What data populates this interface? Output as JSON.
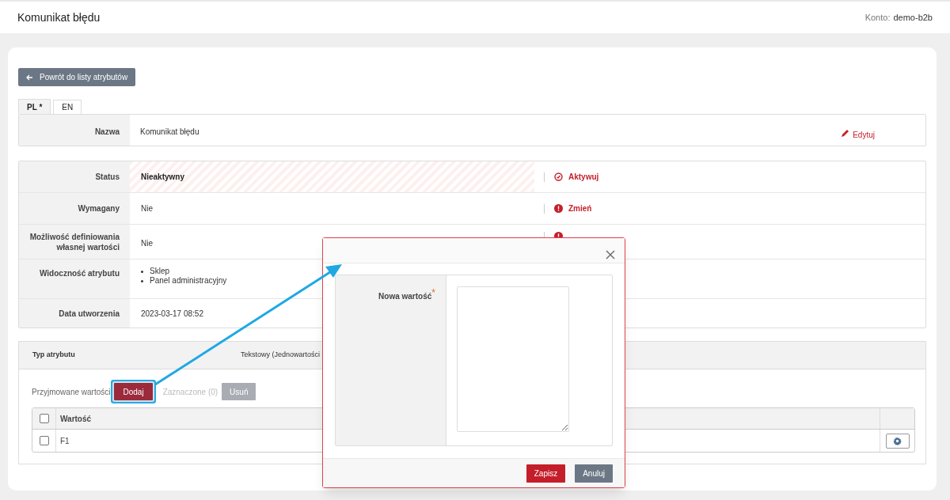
{
  "header": {
    "title": "Komunikat błędu",
    "account_label": "Konto:",
    "account": "demo-b2b"
  },
  "back_button": "Powrót do listy atrybutów",
  "tabs": [
    {
      "label": "PL *",
      "selected": true
    },
    {
      "label": "EN",
      "selected": false
    }
  ],
  "name_row": {
    "label": "Nazwa",
    "value": "Komunikat błędu",
    "action": "Edytuj"
  },
  "properties": [
    {
      "label": "Status",
      "value": "Nieaktywny",
      "kind": "status",
      "action": {
        "kind": "check",
        "label": "Aktywuj"
      }
    },
    {
      "label": "Wymagany",
      "value": "Nie",
      "kind": "text",
      "action": {
        "kind": "alert",
        "label": "Zmień"
      }
    },
    {
      "label": "Możliwość definiowania własnej wartości",
      "value": "Nie",
      "kind": "text",
      "action": {
        "kind": "alert"
      }
    },
    {
      "label": "Widoczność atrybutu",
      "kind": "list",
      "items": [
        "Sklep",
        "Panel administracyjny"
      ]
    },
    {
      "label": "Data utworzenia",
      "value": "2023-03-17 08:52",
      "kind": "text"
    }
  ],
  "attribute_type": {
    "label": "Typ atrybutu",
    "value": "Tekstowy (Jednowartości"
  },
  "values_section": {
    "label": "Przyjmowane wartości",
    "add_button": {
      "label": "Dodaj",
      "highlighted": true
    },
    "selected_count": "Zaznaczone (0)",
    "delete_button": {
      "label": "Usuń",
      "disabled": true
    },
    "table": {
      "columns": [
        "Wartość"
      ],
      "rows": [
        {
          "value": "F1",
          "checked": false
        }
      ],
      "header_checked": false
    }
  },
  "modal": {
    "field_label": "Nowa wartość",
    "required": true,
    "required_mark": "*",
    "buttons": [
      "Zapisz",
      "Anuluj"
    ]
  }
}
